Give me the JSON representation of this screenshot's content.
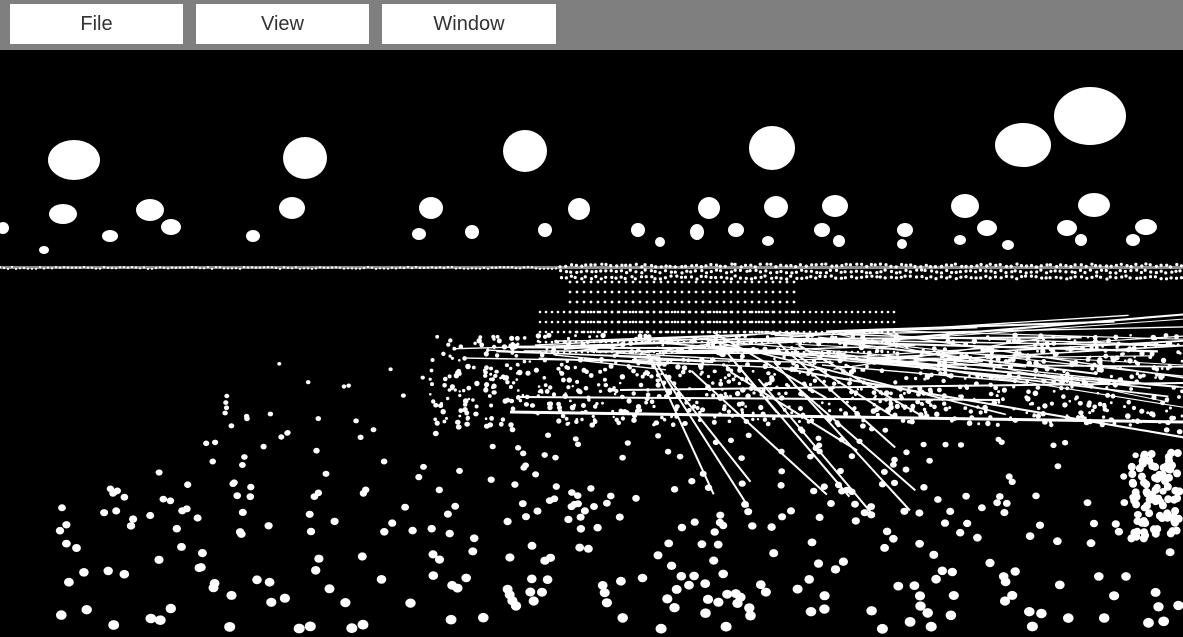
{
  "window": {
    "title": ""
  },
  "menubar": {
    "file_label": "File",
    "view_label": "View",
    "window_label": "Window"
  },
  "viewport": {
    "content": "point-cloud-3d-view",
    "background_color": "#000000",
    "point_color": "#ffffff"
  },
  "colors": {
    "menubar_bg": "#7f7f7f",
    "menu_button_bg": "#ffffff",
    "menu_text": "#333333"
  }
}
